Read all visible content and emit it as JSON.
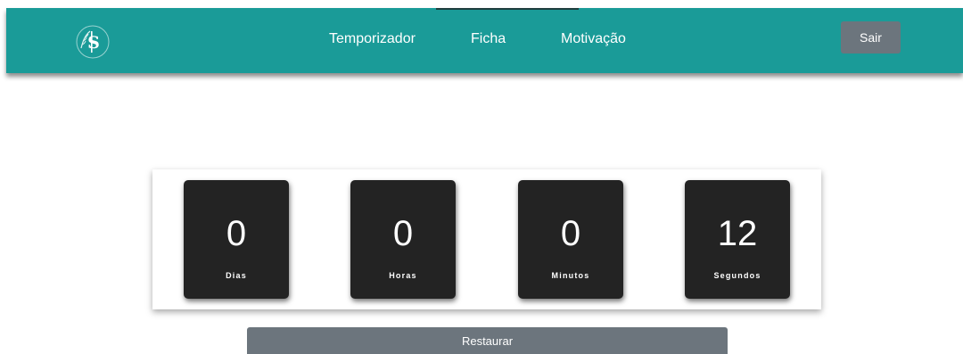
{
  "navbar": {
    "logo_icon": "logo-icon",
    "links": [
      {
        "label": "Temporizador"
      },
      {
        "label": "Ficha"
      },
      {
        "label": "Motivação"
      }
    ],
    "logout_label": "Sair"
  },
  "timer": {
    "units": [
      {
        "value": "0",
        "label": "Dias"
      },
      {
        "value": "0",
        "label": "Horas"
      },
      {
        "value": "0",
        "label": "Minutos"
      },
      {
        "value": "12",
        "label": "Segundos"
      }
    ]
  },
  "restore_label": "Restaurar",
  "colors": {
    "navbar": "#1a9b98",
    "button": "#6c757d",
    "card": "#232323"
  }
}
